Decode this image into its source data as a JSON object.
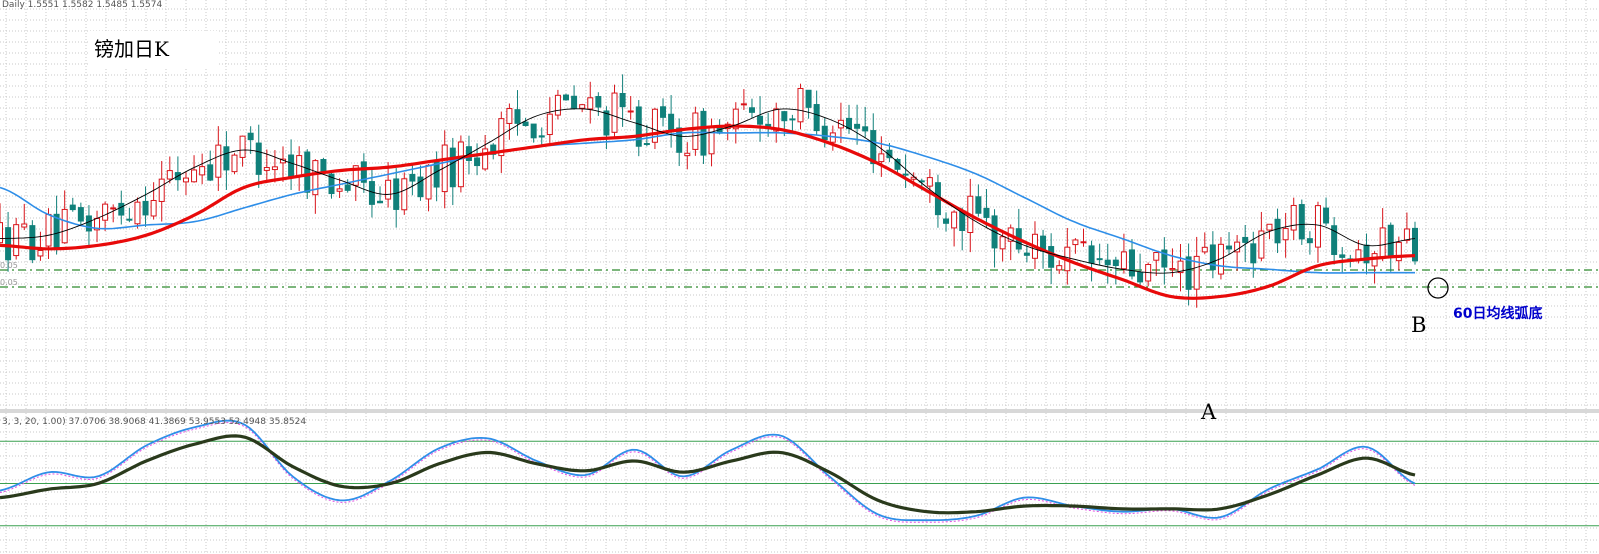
{
  "header_text": "Daily  1.5551 1.5582 1.5485 1.5574",
  "title": "镑加日K",
  "annotation": "60日均线弧底",
  "point_a": "A",
  "point_b": "B",
  "hline_label_1": "0.05",
  "hline_label_2": "0.05",
  "oscillator_header": "3, 3, 20, 1.00) 37.0706 38.9068 41.3869 53.9553 52.4948 35.8524",
  "colors": {
    "bull": "#d8141a",
    "bear": "#10807a",
    "ma_fast": "#000000",
    "ma_mid": "#e80a0a",
    "ma_slow": "#2e8ee8",
    "grid": "#c9c9c9",
    "osc_main": "#2e8ee8",
    "osc_signal": "#2a3a1c",
    "osc_level": "#3aa050",
    "hline": "#2f8a2f"
  },
  "chart_data": [
    {
      "type": "candlestick",
      "title": "镑加日K",
      "series": [
        {
          "name": "",
          "kind": "ma_fast",
          "values": [
            1.53,
            1.531,
            1.536,
            1.543,
            1.551,
            1.556,
            1.552,
            1.547,
            1.543,
            1.55,
            1.558,
            1.566,
            1.568,
            1.564,
            1.56,
            1.563,
            1.568,
            1.565,
            1.557,
            1.545,
            1.535,
            1.528,
            1.524,
            1.521,
            1.52,
            1.524,
            1.532,
            1.534,
            1.528,
            1.53
          ]
        },
        {
          "name": "",
          "kind": "ma_mid",
          "values": [
            1.528,
            1.527,
            1.528,
            1.531,
            1.537,
            1.545,
            1.548,
            1.55,
            1.551,
            1.553,
            1.555,
            1.557,
            1.559,
            1.56,
            1.562,
            1.563,
            1.562,
            1.558,
            1.552,
            1.544,
            1.536,
            1.529,
            1.523,
            1.518,
            1.513,
            1.513,
            1.516,
            1.522,
            1.524,
            1.525
          ]
        },
        {
          "name": "",
          "kind": "ma_slow",
          "values": [
            1.545,
            1.537,
            1.533,
            1.534,
            1.535,
            1.539,
            1.543,
            1.546,
            1.549,
            1.552,
            1.555,
            1.557,
            1.558,
            1.559,
            1.561,
            1.561,
            1.561,
            1.56,
            1.558,
            1.554,
            1.549,
            1.542,
            1.535,
            1.53,
            1.525,
            1.522,
            1.521,
            1.52,
            1.52,
            1.52
          ]
        }
      ]
    },
    {
      "type": "line",
      "title": "",
      "levels": [
        80,
        50,
        20
      ],
      "series": [
        {
          "name": "",
          "kind": "main",
          "values": [
            45,
            58,
            55,
            77,
            90,
            92,
            55,
            38,
            52,
            75,
            82,
            66,
            56,
            74,
            55,
            74,
            84,
            55,
            28,
            24,
            27,
            40,
            34,
            30,
            32,
            26,
            46,
            60,
            76,
            50
          ]
        },
        {
          "name": "",
          "kind": "signal",
          "values": [
            40,
            46,
            50,
            66,
            78,
            83,
            62,
            48,
            50,
            64,
            72,
            64,
            59,
            66,
            58,
            66,
            72,
            58,
            38,
            30,
            30,
            34,
            34,
            32,
            32,
            32,
            42,
            56,
            68,
            56
          ]
        }
      ]
    }
  ]
}
